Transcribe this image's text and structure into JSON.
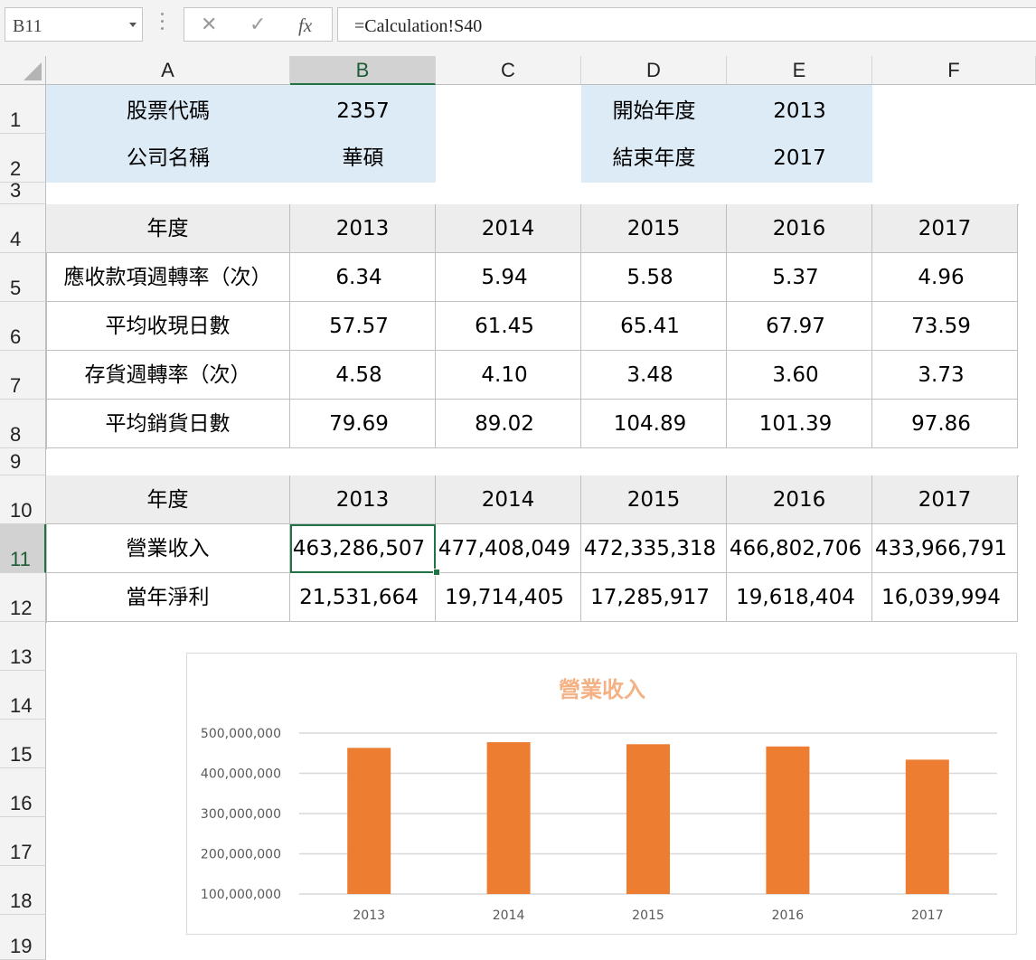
{
  "formula_bar": {
    "name_box": "B11",
    "cancel_symbol": "✕",
    "enter_symbol": "✓",
    "fx_label": "fx",
    "formula": "=Calculation!S40"
  },
  "columns": [
    "A",
    "B",
    "C",
    "D",
    "E",
    "F"
  ],
  "rows": [
    "1",
    "2",
    "3",
    "4",
    "5",
    "6",
    "7",
    "8",
    "9",
    "10",
    "11",
    "12",
    "13",
    "14",
    "15",
    "16",
    "17",
    "18",
    "19"
  ],
  "selected_cell": "B11",
  "info": {
    "stock_code_label": "股票代碼",
    "stock_code": "2357",
    "company_label": "公司名稱",
    "company": "華碩",
    "start_label": "開始年度",
    "start_year": "2013",
    "end_label": "結束年度",
    "end_year": "2017"
  },
  "table1": {
    "header": [
      "年度",
      "2013",
      "2014",
      "2015",
      "2016",
      "2017"
    ],
    "rows": [
      [
        "應收款項週轉率（次）",
        "6.34",
        "5.94",
        "5.58",
        "5.37",
        "4.96"
      ],
      [
        "平均收現日數",
        "57.57",
        "61.45",
        "65.41",
        "67.97",
        "73.59"
      ],
      [
        "存貨週轉率（次）",
        "4.58",
        "4.10",
        "3.48",
        "3.60",
        "3.73"
      ],
      [
        "平均銷貨日數",
        "79.69",
        "89.02",
        "104.89",
        "101.39",
        "97.86"
      ]
    ]
  },
  "table2": {
    "header": [
      "年度",
      "2013",
      "2014",
      "2015",
      "2016",
      "2017"
    ],
    "rows": [
      [
        "營業收入",
        "463,286,507",
        "477,408,049",
        "472,335,318",
        "466,802,706",
        "433,966,791"
      ],
      [
        "當年淨利",
        "21,531,664",
        "19,714,405",
        "17,285,917",
        "19,618,404",
        "16,039,994"
      ]
    ]
  },
  "colors": {
    "info_fill": "#ddebf7",
    "header_fill": "#ededed",
    "selection": "#217346",
    "bar": "#ed7d31",
    "chart_title": "#f4b183"
  },
  "chart_data": {
    "type": "bar",
    "title": "營業收入",
    "categories": [
      "2013",
      "2014",
      "2015",
      "2016",
      "2017"
    ],
    "series": [
      {
        "values": [
          463286507,
          477408049,
          472335318,
          466802706,
          433966791
        ]
      }
    ],
    "y_ticks": [
      "500,000,000",
      "400,000,000",
      "300,000,000",
      "200,000,000",
      "100,000,000"
    ],
    "ylim": [
      100000000,
      500000000
    ],
    "grid": true,
    "legend": "none"
  }
}
